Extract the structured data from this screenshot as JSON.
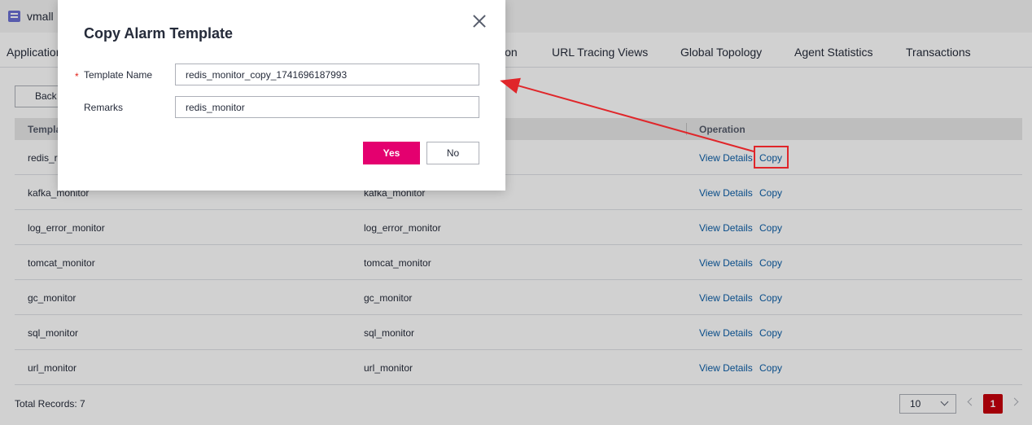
{
  "app": {
    "name": "vmall"
  },
  "tabs": [
    "Application",
    "ion",
    "URL Tracing Views",
    "Global Topology",
    "Agent Statistics",
    "Transactions"
  ],
  "toolbar": {
    "back_label": "Back"
  },
  "table": {
    "headers": {
      "name": "Templa",
      "operation": "Operation"
    },
    "rows": [
      {
        "name": "redis_r",
        "remarks": "",
        "view": "View Details",
        "copy": "Copy"
      },
      {
        "name": "kafka_monitor",
        "remarks": "kafka_monitor",
        "view": "View Details",
        "copy": "Copy"
      },
      {
        "name": "log_error_monitor",
        "remarks": "log_error_monitor",
        "view": "View Details",
        "copy": "Copy"
      },
      {
        "name": "tomcat_monitor",
        "remarks": "tomcat_monitor",
        "view": "View Details",
        "copy": "Copy"
      },
      {
        "name": "gc_monitor",
        "remarks": "gc_monitor",
        "view": "View Details",
        "copy": "Copy"
      },
      {
        "name": "sql_monitor",
        "remarks": "sql_monitor",
        "view": "View Details",
        "copy": "Copy"
      },
      {
        "name": "url_monitor",
        "remarks": "url_monitor",
        "view": "View Details",
        "copy": "Copy"
      }
    ]
  },
  "footer": {
    "total": "Total Records: 7",
    "page_size": "10",
    "current_page": "1"
  },
  "dialog": {
    "title": "Copy Alarm Template",
    "required_mark": "*",
    "template_name_label": "Template Name",
    "template_name_value": "redis_monitor_copy_1741696187993",
    "remarks_label": "Remarks",
    "remarks_value": "redis_monitor",
    "yes_label": "Yes",
    "no_label": "No"
  },
  "colors": {
    "primary": "#e4006f",
    "link": "#0b5ea8",
    "annotation": "#e0262a",
    "page_active": "#c7000b"
  }
}
